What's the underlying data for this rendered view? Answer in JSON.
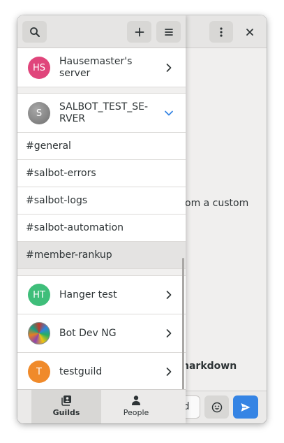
{
  "main": {
    "partial_text": "om a custom",
    "partial_bold_text": "narkdown",
    "composer_partial_text": "ed"
  },
  "sidebar": {
    "guilds": [
      {
        "initials": "HS",
        "name": "Hausemaster's server",
        "color": "#e0457b"
      },
      {
        "initials": "S",
        "name": "SALBOT_TEST_SE-RVER",
        "color": "#868686",
        "expanded": true
      },
      {
        "initials": "HT",
        "name": "Hanger test",
        "color": "#3fbe7a"
      },
      {
        "initials": "",
        "name": "Bot Dev NG",
        "color": "#c0392b"
      },
      {
        "initials": "T",
        "name": "testguild",
        "color": "#f08a2a"
      }
    ],
    "channels": [
      "#general",
      "#salbot-errors",
      "#salbot-logs",
      "#salbot-automation",
      "#member-rankup"
    ],
    "selected_channel": "#member-rankup"
  },
  "view_switcher": {
    "guilds_label": "Guilds",
    "people_label": "People",
    "active": "Guilds"
  },
  "colors": {
    "accent": "#3584e4"
  }
}
